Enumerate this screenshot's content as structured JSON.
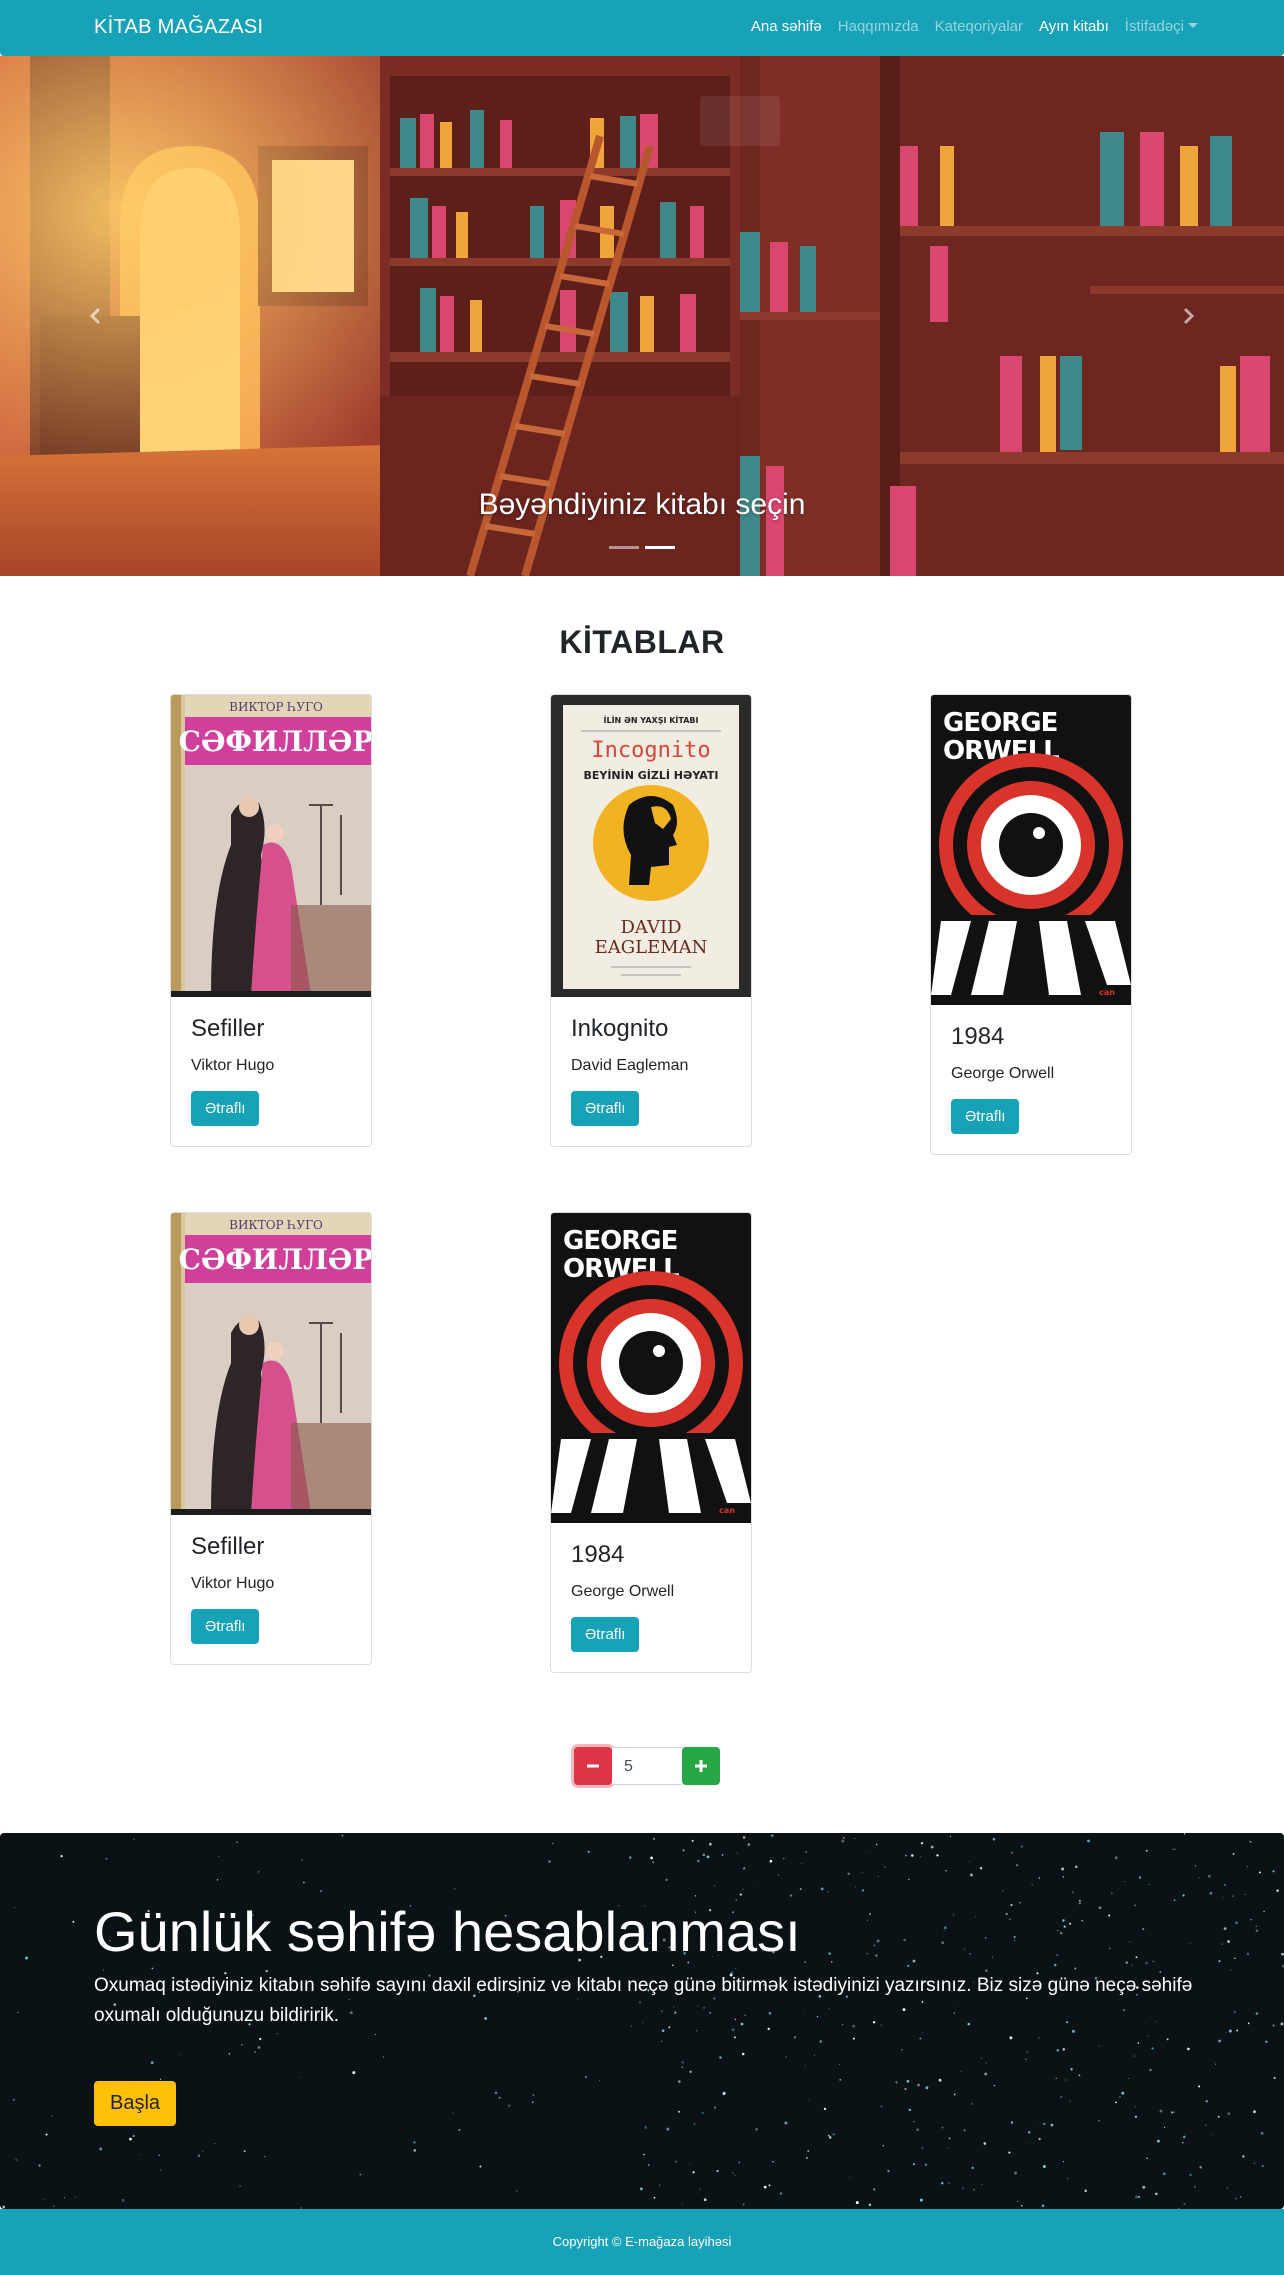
{
  "navbar": {
    "brand": "KİTAB MAĞAZASI",
    "links": [
      {
        "label": "Ana səhifə"
      },
      {
        "label": "Haqqımızda"
      },
      {
        "label": "Kateqoriyalar"
      },
      {
        "label": "Ayın kitabı"
      },
      {
        "label": "İstifadəçi"
      }
    ]
  },
  "carousel": {
    "caption": "Bəyəndiyiniz kitabı seçin",
    "slide_count": 2,
    "active_slide": 2
  },
  "books_section": {
    "title": "KİTABLAR",
    "details_label": "Ətraflı",
    "books": [
      {
        "title": "Sefiller",
        "author": "Viktor Hugo",
        "cover": "sefiller-cover"
      },
      {
        "title": "Inkognito",
        "author": "David Eagleman",
        "cover": "incognito-cover"
      },
      {
        "title": "1984",
        "author": "George Orwell",
        "cover": "1984-cover"
      },
      {
        "title": "Sefiller",
        "author": "Viktor Hugo",
        "cover": "sefiller-cover"
      },
      {
        "title": "1984",
        "author": "George Orwell",
        "cover": "1984-cover"
      }
    ]
  },
  "stepper": {
    "value": "5",
    "minus_icon": "minus-icon",
    "plus_icon": "plus-icon"
  },
  "jumbotron": {
    "heading": "Günlük səhifə hesablanması",
    "text": "Oxumaq istədiyiniz kitabın səhifə sayını daxil edirsiniz və kitabı neçə günə bitirmək istədiyinizi yazırsınız. Biz sizə günə neçə səhifə oxumalı olduğunuzu bildiririk.",
    "button_label": "Başla"
  },
  "covers": {
    "sefiller": {
      "author_line": "ВИКТОР ҺУГО",
      "title_line": "СӘФИЛЛӘР"
    },
    "incognito": {
      "top_line": "İLİN ƏN YAXŞI KİTABI",
      "title": "Incognito",
      "subtitle": "BEYİNİN GİZLİ HƏYATI",
      "author1": "DAVID",
      "author2": "EAGLEMAN"
    },
    "orwell": {
      "author1": "GEORGE",
      "author2": "ORWELL"
    }
  },
  "footer": {
    "text": "Copyright © E-mağaza layihəsi"
  },
  "colors": {
    "primary": "#17a2b8",
    "danger": "#dc3545",
    "success": "#28a745",
    "warning": "#ffc107"
  }
}
